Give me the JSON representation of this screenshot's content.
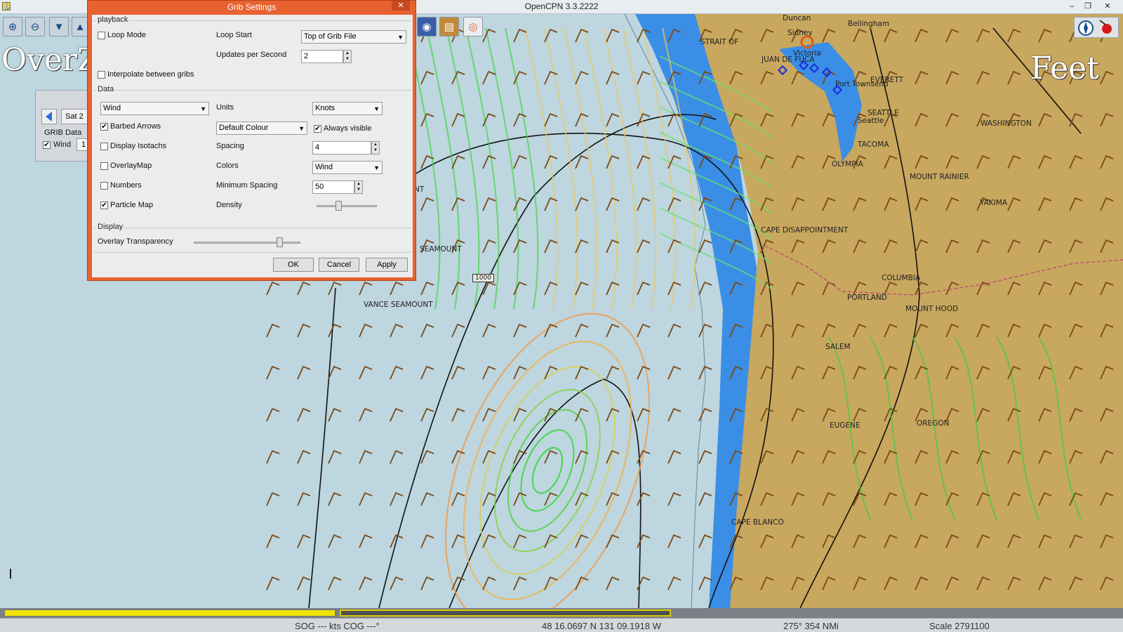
{
  "window": {
    "title": "OpenCPN 3.3.2222",
    "minimize": "–",
    "restore": "❐",
    "close": "✕"
  },
  "overlay": {
    "left_text": "OverZ",
    "right_text": "Feet"
  },
  "grib_bar": {
    "date": "Sat 2",
    "grib_data_label": "GRIB Data",
    "wind_label": "Wind",
    "wind_value": "1"
  },
  "dialog": {
    "title": "Grib Settings",
    "close": "✕",
    "playback": {
      "group_label": "playback",
      "loop_mode_label": "Loop Mode",
      "loop_mode_checked": false,
      "loop_start_label": "Loop Start",
      "loop_start_value": "Top of Grib File",
      "updates_label": "Updates per Second",
      "updates_value": "2",
      "interpolate_label": "Interpolate between gribs",
      "interpolate_checked": false
    },
    "data": {
      "group_label": "Data",
      "variable_value": "Wind",
      "units_label": "Units",
      "units_value": "Knots",
      "barbed_label": "Barbed Arrows",
      "barbed_checked": true,
      "colour_value": "Default Colour",
      "always_visible_label": "Always visible",
      "always_visible_checked": true,
      "isotachs_label": "Display Isotachs",
      "isotachs_checked": false,
      "spacing_label": "Spacing",
      "spacing_value": "4",
      "overlay_label": "OverlayMap",
      "overlay_checked": false,
      "colors_label": "Colors",
      "colors_value": "Wind",
      "numbers_label": "Numbers",
      "numbers_checked": false,
      "min_spacing_label": "Minimum Spacing",
      "min_spacing_value": "50",
      "particle_label": "Particle Map",
      "particle_checked": true,
      "density_label": "Density",
      "density_level": 0.36
    },
    "display": {
      "group_label": "Display",
      "transparency_label": "Overlay Transparency",
      "transparency_level": 0.8
    },
    "buttons": {
      "ok": "OK",
      "cancel": "Cancel",
      "apply": "Apply"
    }
  },
  "map_labels": [
    "Duncan",
    "Bellingham",
    "Sidney",
    "STRAIT OF",
    "JUAN DE FUCA",
    "Victoria",
    "EVERETT",
    "Port Townsend",
    "SEATTLE",
    "Seattle",
    "TACOMA",
    "WASHINGTON",
    "OLYMPIA",
    "MOUNT RAINIER",
    "YAKIMA",
    "CAPE DISAPPOINTMENT",
    "COLUMBIA",
    "PORTLAND",
    "MOUNT HOOD",
    "SALEM",
    "EUGENE",
    "OREGON",
    "CAPE BLANCO",
    "SEAMOUNT",
    "VANCE SEAMOUNT",
    "NT",
    "1000"
  ],
  "status_bar": {
    "sog_cog": "SOG --- kts COG ---°",
    "position": "48 16.0697 N   131 09.1918 W",
    "bearing": "275°  354 NMi",
    "scale": "Scale 2791100"
  },
  "colors": {
    "sea": "#bdd6df",
    "shallow": "#3a8ee6",
    "land": "#c8a75e",
    "barb": "#7a4a1a",
    "dialog_frame": "#e8622f",
    "progress_yellow": "#f0e400"
  }
}
